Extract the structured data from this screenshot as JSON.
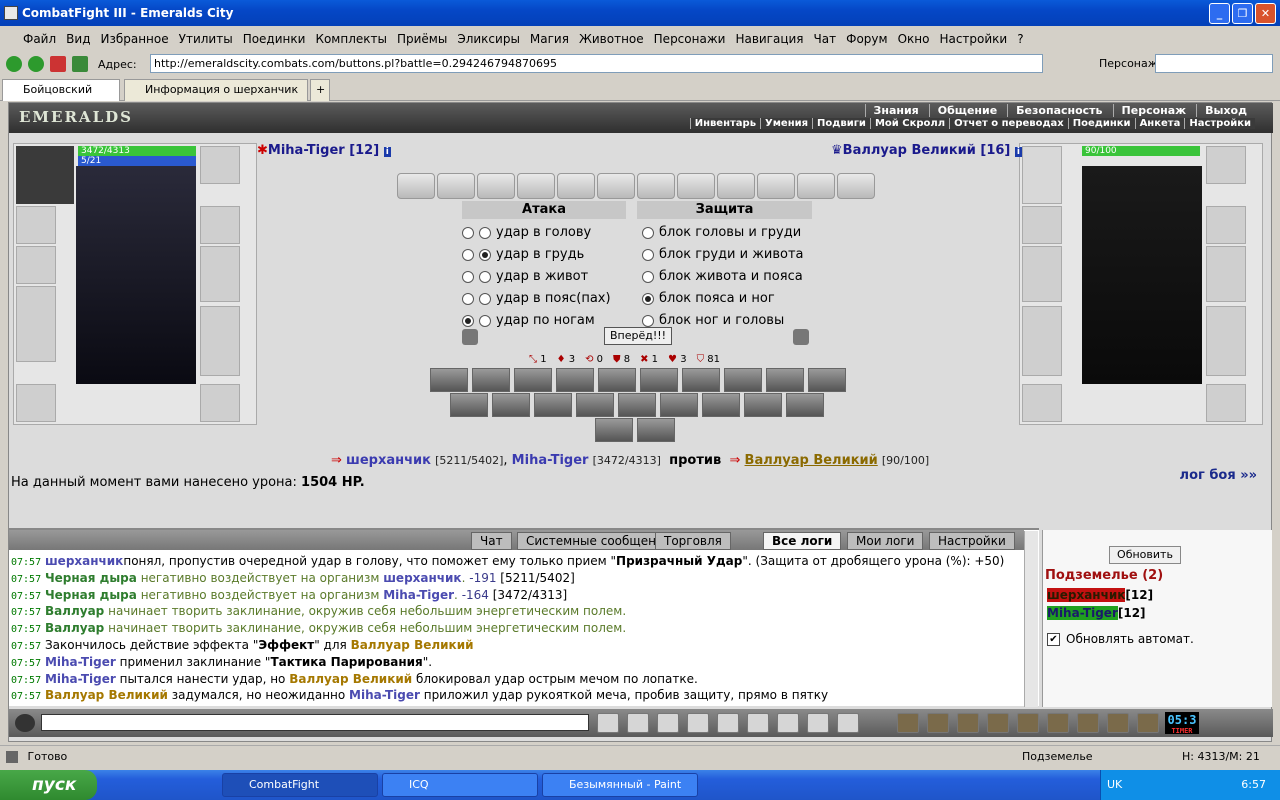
{
  "window": {
    "title": "CombatFight III - Emeralds City"
  },
  "menu": [
    "Файл",
    "Вид",
    "Избранное",
    "Утилиты",
    "Поединки",
    "Комплекты",
    "Приёмы",
    "Эликсиры",
    "Магия",
    "Животное",
    "Персонажи",
    "Навигация",
    "Чат",
    "Форум",
    "Окно",
    "Настройки",
    "?"
  ],
  "address": {
    "label": "Адрес:",
    "value": "http://emeraldscity.combats.com/buttons.pl?battle=0.294246794870695",
    "persona_label": "Персонаж:"
  },
  "tabs": [
    {
      "label": "Бойцовский клуб"
    },
    {
      "label": "Информация о шерханчик"
    }
  ],
  "header": {
    "logo": "EMERALDS",
    "top_links": [
      "Знания",
      "Общение",
      "Безопасность",
      "Персонаж",
      "Выход"
    ],
    "sub_links": [
      "Инвентарь",
      "Умения",
      "Подвиги",
      "Мой Скролл",
      "Отчет о переводах",
      "Поединки",
      "Анкета",
      "Настройки"
    ]
  },
  "player": {
    "name": "Miha-Tiger [12]",
    "hp": "3472/4313",
    "mana": "5/21"
  },
  "enemy": {
    "name": "Валлуар Великий [16]",
    "hp": "90/100"
  },
  "attack": {
    "title": "Атака",
    "options": [
      "удар в голову",
      "удар в грудь",
      "удар в живот",
      "удар в пояс(пах)",
      "удар по ногам"
    ]
  },
  "defense": {
    "title": "Защита",
    "options": [
      "блок головы и груди",
      "блок груди и живота",
      "блок живота и пояса",
      "блок пояса и ног",
      "блок ног и головы"
    ]
  },
  "go_button": "Вперёд!!!",
  "stats": [
    "1",
    "3",
    "0",
    "8",
    "1",
    "3",
    "81"
  ],
  "fight": {
    "ally1": "шерханчик",
    "ally1_hp": "[5211/5402]",
    "ally2": "Miha-Tiger",
    "ally2_hp": "[3472/4313]",
    "vs": "против",
    "foe": "Валлуар Великий",
    "foe_hp": "[90/100]"
  },
  "damage": {
    "prefix": "На данный момент вами нанесено урона:",
    "value": "1504 HP."
  },
  "log_link": "лог боя »»",
  "chat_tabs": [
    "Чат",
    "Системные сообщения",
    "Торговля",
    "Все логи",
    "Мои логи",
    "Настройки"
  ],
  "log": [
    {
      "time": "07:57",
      "parts": [
        [
          "blue",
          "шерханчик"
        ],
        [
          "",
          "понял, пропустив очередной удар в голову, что поможет ему только прием \""
        ],
        [
          "b",
          "Призрачный Удар"
        ],
        [
          "",
          "\". (Защита от дробящего урона (%): +50)"
        ]
      ]
    },
    {
      "time": "07:57",
      "parts": [
        [
          "green",
          "Черная дыра"
        ],
        [
          "olive",
          " негативно воздействует на организм "
        ],
        [
          "blue",
          "шерханчик"
        ],
        [
          "olive",
          ". "
        ],
        [
          "dark",
          "-191"
        ],
        [
          "",
          "",
          " [5211/5402]"
        ]
      ]
    },
    {
      "time": "07:57",
      "parts": [
        [
          "green",
          "Черная дыра"
        ],
        [
          "olive",
          " негативно воздействует на организм "
        ],
        [
          "blue",
          "Miha-Tiger"
        ],
        [
          "olive",
          ". "
        ],
        [
          "dark",
          "-164"
        ],
        [
          "",
          "",
          " [3472/4313]"
        ]
      ]
    },
    {
      "time": "07:57",
      "parts": [
        [
          "green",
          "Валлуар"
        ],
        [
          "olive",
          " начинает творить заклинание, окружив себя небольшим энергетическим полем."
        ]
      ]
    },
    {
      "time": "07:57",
      "parts": [
        [
          "green",
          "Валлуар"
        ],
        [
          "olive",
          " начинает творить заклинание, окружив себя небольшим энергетическим полем."
        ]
      ]
    },
    {
      "time": "07:57",
      "parts": [
        [
          "",
          "Закончилось действие эффекта \""
        ],
        [
          "b",
          "Эффект"
        ],
        [
          "",
          "\" для "
        ],
        [
          "gold",
          "Валлуар Великий"
        ]
      ]
    },
    {
      "time": "07:57",
      "parts": [
        [
          "blue",
          "Miha-Tiger"
        ],
        [
          "",
          " применил заклинание \""
        ],
        [
          "b",
          "Тактика Парирования"
        ],
        [
          "",
          "\"."
        ]
      ]
    },
    {
      "time": "07:57",
      "parts": [
        [
          "blue",
          "Miha-Tiger"
        ],
        [
          "",
          " пытался нанести удар, но "
        ],
        [
          "gold",
          "Валлуар Великий"
        ],
        [
          "",
          " блокировал удар острым мечом по лопатке."
        ]
      ]
    },
    {
      "time": "07:57",
      "parts": [
        [
          "gold",
          "Валлуар Великий"
        ],
        [
          "",
          " задумался, но неожиданно "
        ],
        [
          "blue",
          "Miha-Tiger"
        ],
        [
          "",
          " приложил удар рукояткой меча, пробив защиту, прямо в пятку"
        ]
      ]
    }
  ],
  "right": {
    "refresh": "Обновить",
    "dungeon": "Подземелье (2)",
    "players": [
      {
        "name": "шерханчик",
        "level": "[12]"
      },
      {
        "name": "Miha-Tiger",
        "level": "[12]"
      }
    ],
    "auto": "Обновлять автомат."
  },
  "timer": {
    "time": "05:3",
    "label": "TIMER"
  },
  "status": {
    "ready": "Готово",
    "zone": "Подземелье",
    "hm": "H: 4313/M: 21"
  },
  "taskbar": {
    "start": "пуск",
    "items": [
      "CombatFight",
      "ICQ",
      "Безымянный - Paint"
    ],
    "lang": "UK",
    "clock": "6:57"
  }
}
